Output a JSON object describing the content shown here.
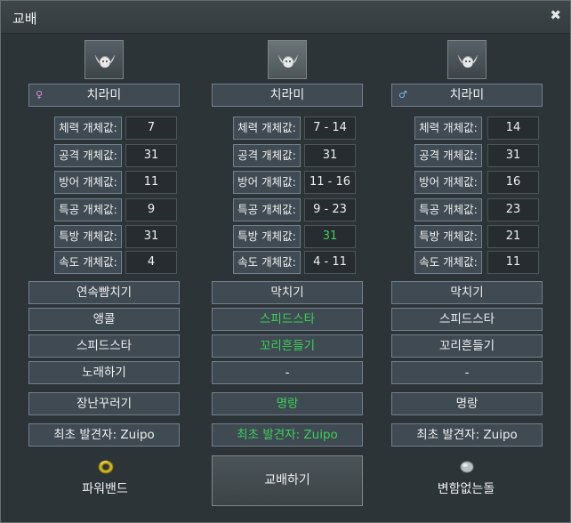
{
  "window": {
    "title": "교배",
    "close_glyph": "✖"
  },
  "left": {
    "icon": "chiramii-sprite-icon",
    "gender": "♀",
    "name": "치라미",
    "stats": [
      {
        "label": "체력 개체값:",
        "value": "7"
      },
      {
        "label": "공격 개체값:",
        "value": "31"
      },
      {
        "label": "방어 개체값:",
        "value": "11"
      },
      {
        "label": "특공 개체값:",
        "value": "9"
      },
      {
        "label": "특방 개체값:",
        "value": "31"
      },
      {
        "label": "속도 개체값:",
        "value": "4"
      }
    ],
    "moves": [
      "연속뺨치기",
      "앵콜",
      "스피드스타",
      "노래하기",
      "장난꾸러기"
    ],
    "finder": "최초 발견자: Zuipo",
    "item": {
      "icon": "power-band-icon",
      "label": "파워밴드"
    }
  },
  "middle": {
    "icon": "chiramii-sprite-icon",
    "name": "치라미",
    "stats": [
      {
        "label": "체력 개체값:",
        "value": "7 - 14"
      },
      {
        "label": "공격 개체값:",
        "value": "31"
      },
      {
        "label": "방어 개체값:",
        "value": "11 - 16"
      },
      {
        "label": "특공 개체값:",
        "value": "9 - 23"
      },
      {
        "label": "특방 개체값:",
        "value": "31",
        "highlight": true
      },
      {
        "label": "속도 개체값:",
        "value": "4 - 11"
      }
    ],
    "moves": [
      "막치기",
      "스피드스타",
      "꼬리흔들기",
      "-",
      "명랑"
    ],
    "finder": "최초 발견자: Zuipo",
    "breed_button": "교배하기"
  },
  "right": {
    "icon": "chiramii-sprite-icon",
    "gender": "♂",
    "name": "치라미",
    "stats": [
      {
        "label": "체력 개체값:",
        "value": "14"
      },
      {
        "label": "공격 개체값:",
        "value": "31"
      },
      {
        "label": "방어 개체값:",
        "value": "16"
      },
      {
        "label": "특공 개체값:",
        "value": "23"
      },
      {
        "label": "특방 개체값:",
        "value": "21"
      },
      {
        "label": "속도 개체값:",
        "value": "11"
      }
    ],
    "moves": [
      "막치기",
      "스피드스타",
      "꼬리흔들기",
      "-",
      "명랑"
    ],
    "finder": "최초 발견자: Zuipo",
    "item": {
      "icon": "everstone-icon",
      "label": "변함없는돌"
    }
  },
  "colors": {
    "highlight_green": "#3dd05a",
    "female": "#e08ad8",
    "male": "#7fb2e8"
  }
}
